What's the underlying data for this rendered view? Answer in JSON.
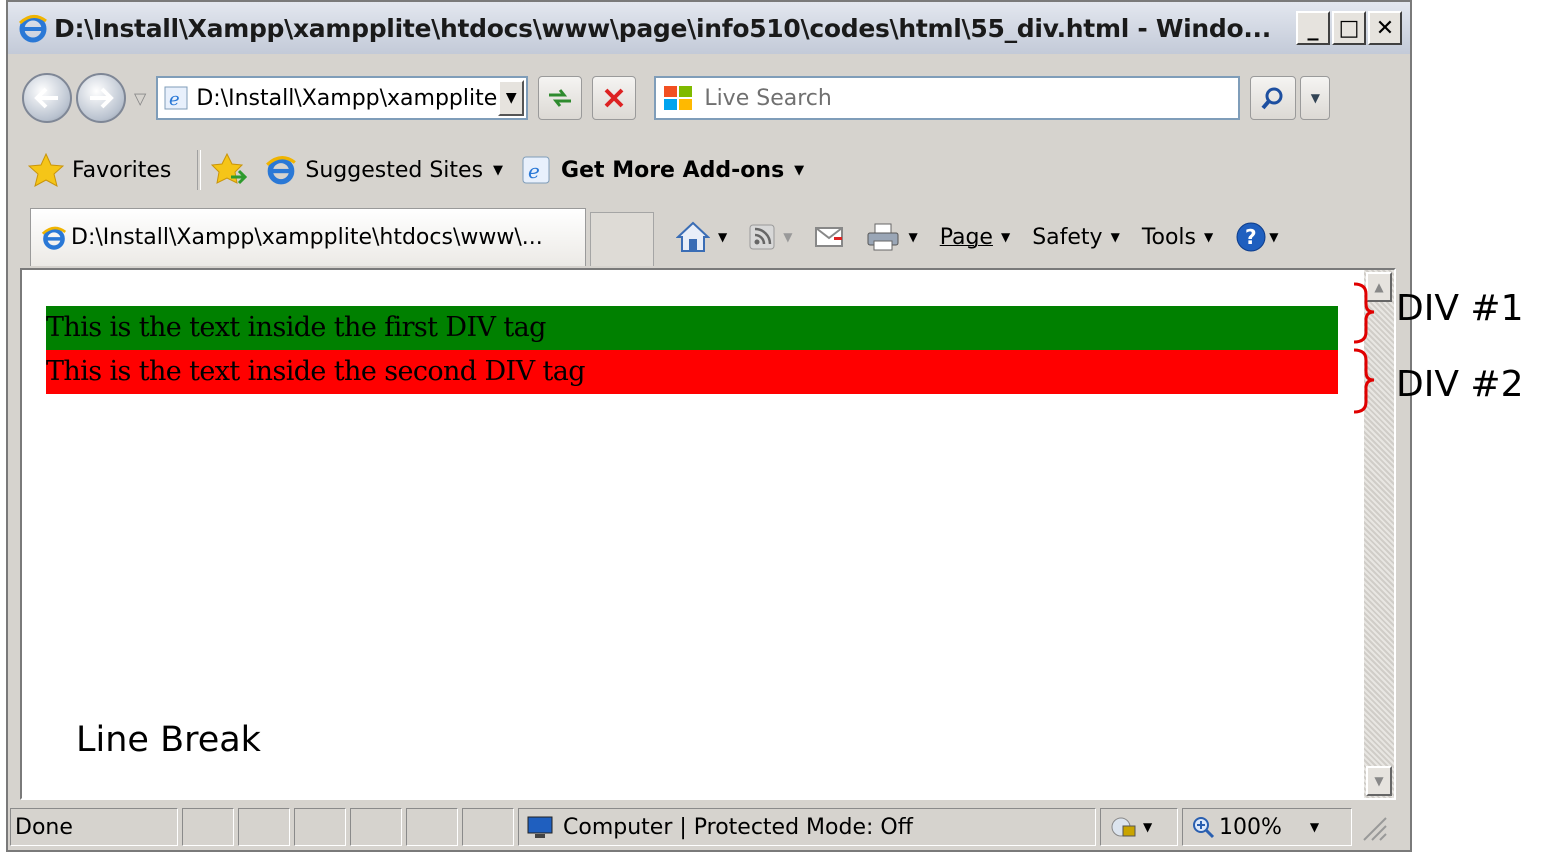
{
  "window": {
    "title": "D:\\Install\\Xampp\\xampplite\\htdocs\\www\\page\\info510\\codes\\html\\55_div.html - Windo...",
    "minimize": "_",
    "maximize": "□",
    "close": "✕"
  },
  "nav": {
    "address": "D:\\Install\\Xampp\\xampplite",
    "search_placeholder": "Live Search"
  },
  "favorites": {
    "favorites_label": "Favorites",
    "suggested_label": "Suggested Sites",
    "addons_label": "Get More Add-ons"
  },
  "tab": {
    "label": "D:\\Install\\Xampp\\xampplite\\htdocs\\www\\..."
  },
  "commands": {
    "page": "Page",
    "safety": "Safety",
    "tools": "Tools"
  },
  "content": {
    "div1_text": "This is the text inside the first DIV tag",
    "div2_text": "This is the text inside the second DIV tag",
    "div1_color": "#008000",
    "div2_color": "#ff0000"
  },
  "status": {
    "done": "Done",
    "zone": "Computer | Protected Mode: Off",
    "zoom": "100%"
  },
  "annotations": {
    "div1_label": "DIV #1",
    "div2_label": "DIV #2",
    "line_break_label": "Line Break",
    "brace_color": "#e00000"
  }
}
